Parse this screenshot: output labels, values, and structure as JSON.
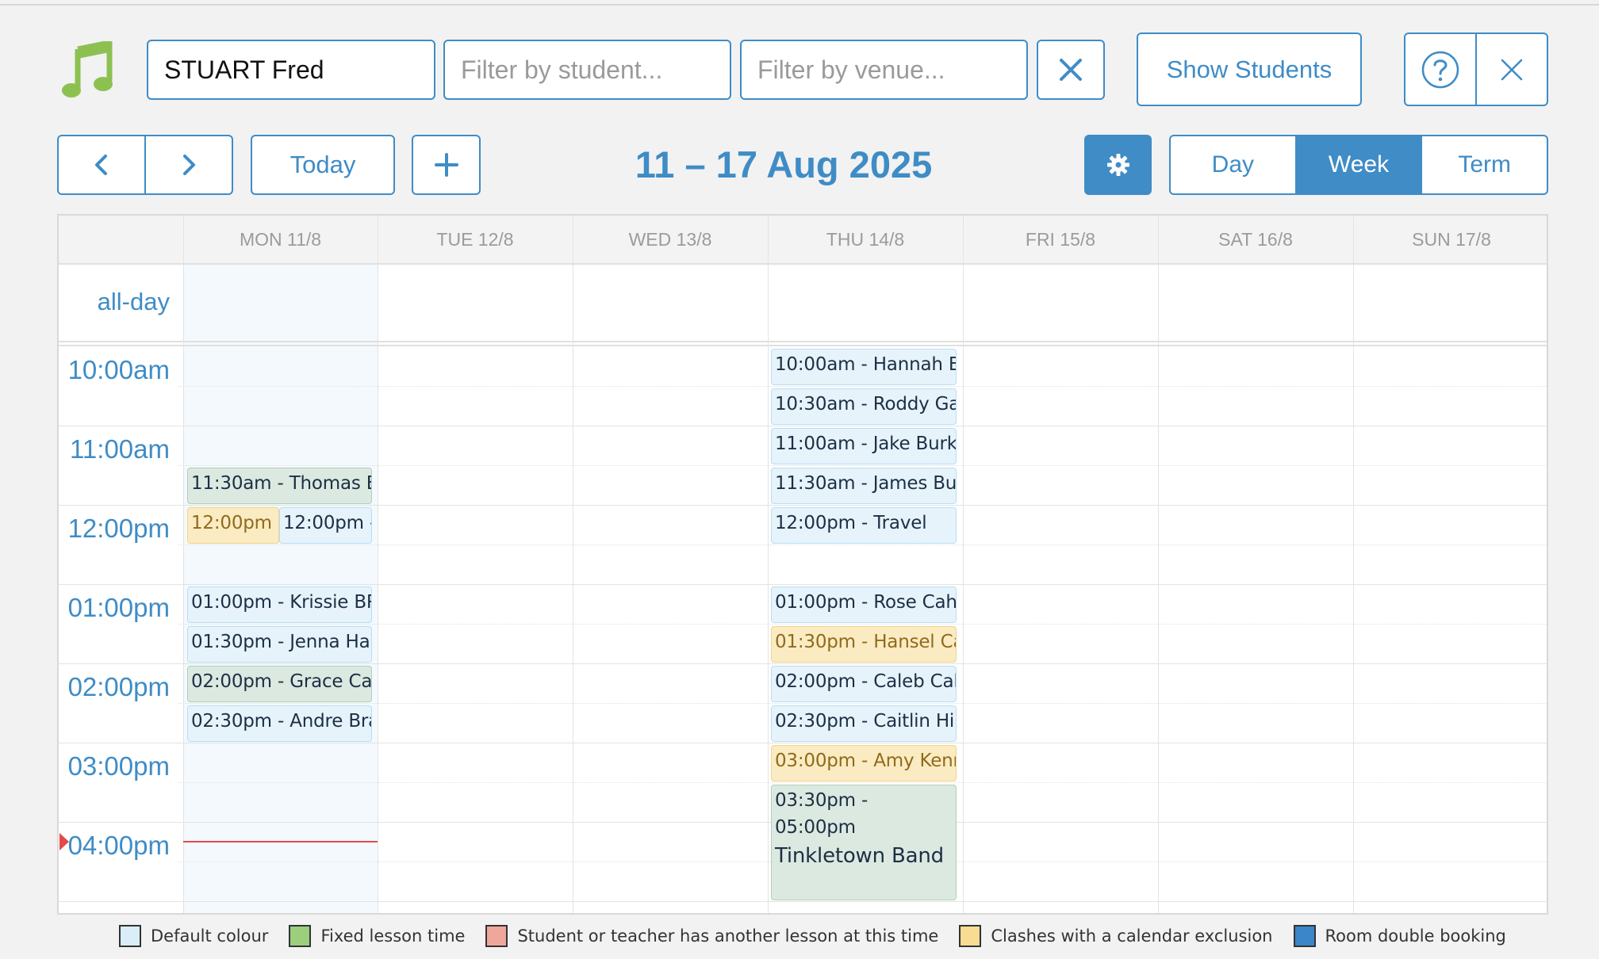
{
  "toolbar": {
    "teacher_value": "STUART Fred",
    "student_placeholder": "Filter by student...",
    "venue_placeholder": "Filter by venue...",
    "clear_icon": "close-icon",
    "show_students_label": "Show Students",
    "help_icon": "question-circle-icon",
    "close_icon": "close-icon"
  },
  "nav": {
    "today_label": "Today",
    "date_range": "11 – 17 Aug 2025",
    "views": [
      "Day",
      "Week",
      "Term"
    ],
    "active_view": "Week"
  },
  "calendar": {
    "days": [
      "MON 11/8",
      "TUE 12/8",
      "WED 13/8",
      "THU 14/8",
      "FRI 15/8",
      "SAT 16/8",
      "SUN 17/8"
    ],
    "allday_label": "all-day",
    "time_labels": [
      "10:00am",
      "11:00am",
      "12:00pm",
      "01:00pm",
      "02:00pm",
      "03:00pm",
      "04:00pm"
    ],
    "events": {
      "mon": [
        {
          "text": "11:30am - Thomas B",
          "type": "fixed"
        },
        {
          "text": "12:00pm - ",
          "type": "exclusion"
        },
        {
          "text": "12:00pm - ",
          "type": "default"
        },
        {
          "text": "01:00pm - Krissie BR",
          "type": "default"
        },
        {
          "text": "01:30pm - Jenna Har",
          "type": "default"
        },
        {
          "text": "02:00pm - Grace Ca",
          "type": "fixed"
        },
        {
          "text": "02:30pm - Andre Bra",
          "type": "default"
        }
      ],
      "thu": [
        {
          "text": "10:00am - Hannah B",
          "type": "default"
        },
        {
          "text": "10:30am - Roddy Ga",
          "type": "default"
        },
        {
          "text": "11:00am - Jake Burk",
          "type": "default"
        },
        {
          "text": "11:30am - James Bu",
          "type": "default"
        },
        {
          "text": "12:00pm - Travel",
          "type": "default"
        },
        {
          "text": "01:00pm - Rose Cah",
          "type": "default"
        },
        {
          "text": "01:30pm - Hansel Ca",
          "type": "exclusion"
        },
        {
          "text": "02:00pm - Caleb Cal",
          "type": "default"
        },
        {
          "text": "02:30pm - Caitlin Hi",
          "type": "default"
        },
        {
          "text": "03:00pm - Amy Kenr",
          "type": "exclusion"
        },
        {
          "text": "03:30pm - 05:00pm",
          "title": "Tinkletown Band",
          "type": "fixed"
        }
      ]
    }
  },
  "legend": [
    {
      "label": "Default colour",
      "color": "#d9eef9"
    },
    {
      "label": "Fixed lesson time",
      "color": "#9ccf7c"
    },
    {
      "label": "Student or teacher has another lesson at this time",
      "color": "#f0a79b"
    },
    {
      "label": "Clashes with a calendar exclusion",
      "color": "#f8dc94"
    },
    {
      "label": "Room double booking",
      "color": "#3a86c8"
    }
  ],
  "colors": {
    "accent": "#3f8cc6",
    "logo_green": "#8cc152",
    "now_line": "#e14b4b"
  }
}
